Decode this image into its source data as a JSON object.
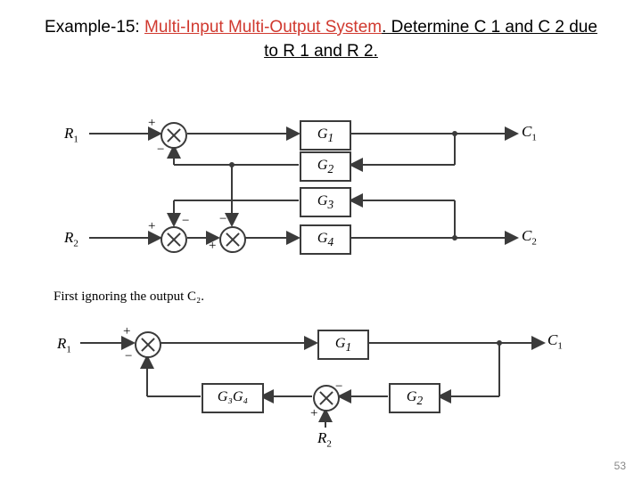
{
  "title": {
    "prefix": "Example-15: ",
    "red": "Multi-Input Multi-Output System",
    "suffix": ". Determine  C 1 and C 2 due to R 1 and R 2."
  },
  "labels": {
    "R1": "R",
    "R1sub": "1",
    "R2": "R",
    "R2sub": "2",
    "C1": "C",
    "C1sub": "1",
    "C2": "C",
    "C2sub": "2",
    "G1": "G",
    "G1sub": "1",
    "G2": "G",
    "G2sub": "2",
    "G3": "G",
    "G3sub": "3",
    "G4": "G",
    "G4sub": "4",
    "G3G4": "G₃G₄"
  },
  "signs": {
    "plus": "+",
    "minus": "−"
  },
  "note": "First ignoring the output  C₂.",
  "page": "53"
}
